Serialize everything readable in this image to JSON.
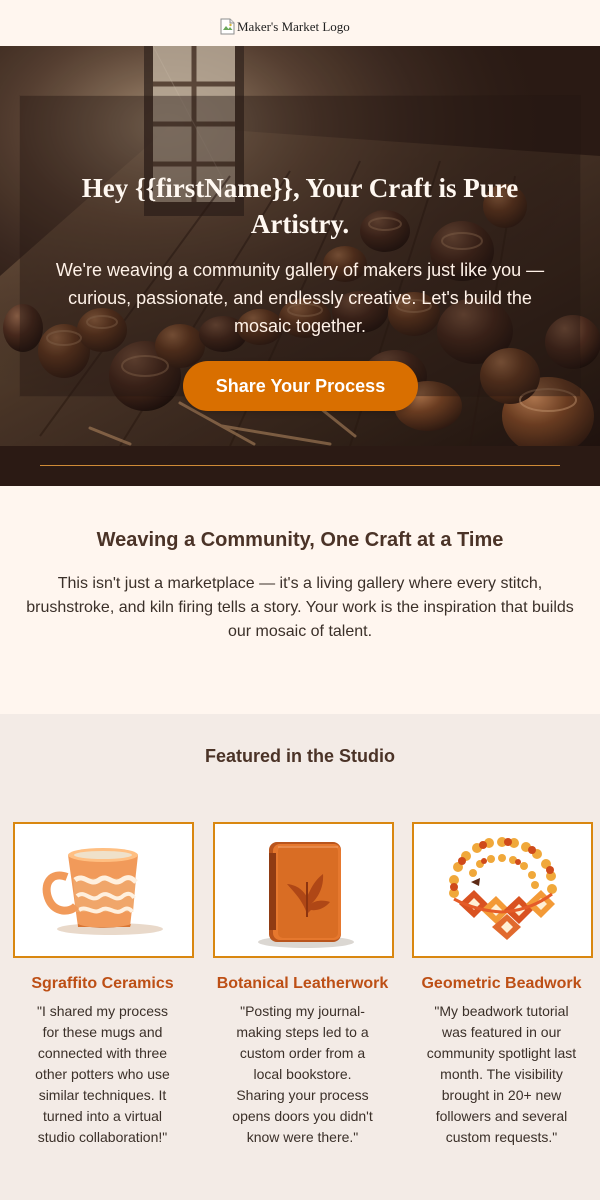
{
  "header": {
    "logo_alt": "Maker's Market Logo"
  },
  "hero": {
    "title": "Hey {{firstName}}, Your Craft is Pure Artistry.",
    "body": "We're weaving a community gallery of makers just like you — curious, passionate, and endlessly creative. Let's build the mosaic together.",
    "button_label": "Share Your Process"
  },
  "community": {
    "title": "Weaving a Community, One Craft at a Time",
    "body": "This isn't just a marketplace — it's a living gallery where every stitch, brushstroke, and kiln firing tells a story. Your work is the inspiration that builds our mosaic of talent."
  },
  "studio": {
    "title": "Featured in the Studio",
    "features": [
      {
        "title": "Sgraffito Ceramics",
        "quote": "\"I shared my process for these mugs and connected with three other potters who use similar techniques. It turned into a virtual studio collaboration!\"",
        "icon": "mug-icon"
      },
      {
        "title": "Botanical Leatherwork",
        "quote": "\"Posting my journal-making steps led to a custom order from a local bookstore. Sharing your process opens doors you didn't know were there.\"",
        "icon": "leather-journal-icon"
      },
      {
        "title": "Geometric Beadwork",
        "quote": "\"My beadwork tutorial was featured in our community spotlight last month. The visibility brought in 20+ new followers and several custom requests.\"",
        "icon": "beaded-necklace-icon"
      }
    ]
  },
  "colors": {
    "cream": "#fff6ef",
    "studio_background": "#f3ebe6",
    "accent": "#d96f00",
    "feature_title": "#bd4f15",
    "brown_text": "#4b3327"
  }
}
